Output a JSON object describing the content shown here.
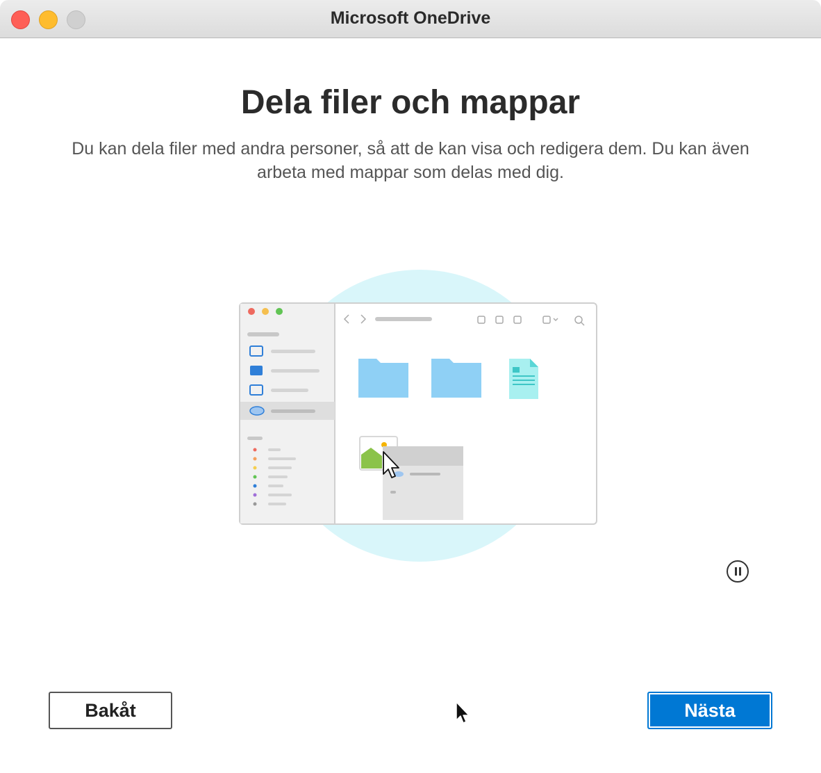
{
  "window": {
    "title": "Microsoft OneDrive"
  },
  "page": {
    "heading": "Dela filer och mappar",
    "subtitle": "Du kan dela filer med andra personer, så att de kan visa och redigera dem. Du kan även arbeta med mappar som delas med dig."
  },
  "buttons": {
    "back_label": "Bakåt",
    "next_label": "Nästa"
  },
  "colors": {
    "accent": "#0078d4",
    "illustration_bg": "#d9f6fa",
    "folder": "#8fd0f5",
    "document": "#a8f0f0"
  },
  "icons": {
    "pause": "pause-icon",
    "cursor": "mouse-pointer-icon"
  }
}
